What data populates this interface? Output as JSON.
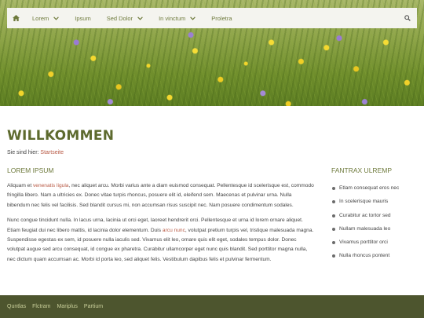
{
  "nav": {
    "items": [
      {
        "label": "Lorem",
        "dropdown": true
      },
      {
        "label": "Ipsum",
        "dropdown": false
      },
      {
        "label": "Sed Dolor",
        "dropdown": true
      },
      {
        "label": "In vinctum",
        "dropdown": true
      },
      {
        "label": "Proletra",
        "dropdown": false
      }
    ]
  },
  "page": {
    "title": "WILLKOMMEN",
    "breadcrumb_prefix": "Sie sind hier: ",
    "breadcrumb_link": "Startseite"
  },
  "main": {
    "heading": "LOREM IPSUM",
    "p1_a": "Aliquam et ",
    "p1_link": "venenatis ligula",
    "p1_b": ", nec aliquet arcu. Morbi varius ante a diam euismod consequat. Pellentesque id scelerisque est, commodo fringilla libero. Nam a ultricies ex. Donec vitae turpis rhoncus, posuere elit id, eleifend sem. Maecenas et pulvinar urna. Nulla bibendum nec felis vel facilisis. Sed blandit cursus mi, non accumsan risus suscipit nec. Nam posuere condimentum sodales.",
    "p2_a": "Nunc congue tincidunt nulla. In lacus urna, lacinia ut orci eget, laoreet hendrerit orci. Pellentesque et urna id lorem ornare aliquet. Etiam feugiat dui nec libero mattis, id lacinia dolor elementum. Duis ",
    "p2_link": "arcu nunc",
    "p2_b": ", volutpat pretium turpis vel, tristique malesuada magna. Suspendisse egestas ex sem, id posuere nulla iaculis sed. Vivamus elit leo, ornare quis elit eget, sodales tempus dolor. Donec volutpat augue sed arcu consequat, id congue ex pharetra. Curabitur ullamcorper eget nunc quis blandit. Sed porttitor magna nulla, nec dictum quam accumsan ac. Morbi id porta leo, sed aliquet felis. Vestibulum dapibus felis et pulvinar fermentum."
  },
  "sidebar": {
    "heading": "FANTRAX ULREMP",
    "items": [
      "Etlam consequat eros nec",
      "In scelerisque mauris",
      "Curabitur ac tortor sed",
      "Nullam malesuada leo",
      "Vivamus porttitor orci",
      "Nulla rhoncus pontent"
    ]
  },
  "footer": {
    "links": [
      "Quntlas",
      "Flctram",
      "Mariplus",
      "Partium"
    ]
  },
  "colors": {
    "accent": "#6e7a3c",
    "link": "#b85a45",
    "footer_bg": "#4d552e",
    "nav_bg": "#f4f4ef"
  },
  "icons": {
    "home": "home-icon",
    "search": "search-icon",
    "dropdown": "chevron-down-icon"
  }
}
